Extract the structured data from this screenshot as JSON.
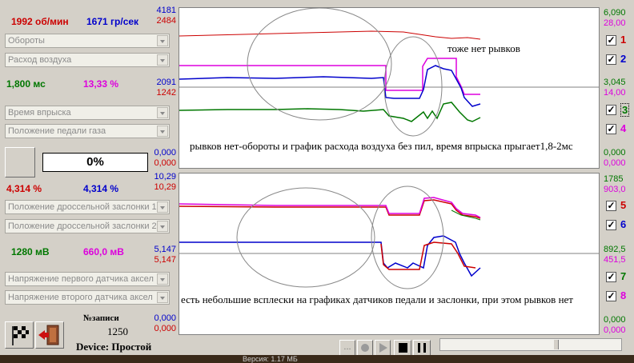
{
  "left": {
    "rpm": "1992 об/мин",
    "airflow_rate": "1671 гр/сек",
    "combo1": "Обороты",
    "combo2": "Расход воздуха",
    "injection_ms": "1,800 мс",
    "percent1": "13,33 %",
    "combo3": "Время впрыска",
    "combo4": "Положение педали газа",
    "progress": "0%",
    "throttle_pct_a": "4,314 %",
    "throttle_pct_b": "4,314 %",
    "combo5": "Положение дроссельной заслонки 1",
    "combo6": "Положение дроссельной заслонки 2",
    "mv1": "1280 мВ",
    "mv2": "660,0 мВ",
    "combo7": "Напряжение первого датчика аксел",
    "combo8": "Напряжение второго датчика аксел",
    "record_label": "№записи",
    "record_value": "1250",
    "device": "Device:  Простой"
  },
  "axes": {
    "top_left": [
      "4181",
      "2484",
      "2091",
      "1242",
      "0,000",
      "0,000"
    ],
    "top_right": [
      "6,090",
      "28,00",
      "3,045",
      "14,00",
      "0,000",
      "0,000"
    ],
    "bottom_left": [
      "10,29",
      "10,29",
      "5,147",
      "5,147",
      "0,000",
      "0,000"
    ],
    "bottom_right": [
      "1785",
      "903,0",
      "892,5",
      "451,5",
      "0,000",
      "0,000"
    ]
  },
  "checkboxes": [
    "1",
    "2",
    "3",
    "4",
    "5",
    "6",
    "7",
    "8"
  ],
  "check_mark": "✓",
  "annotations": {
    "top_note": "тоже нет рывков",
    "mid_note": "рывков нет-обороты и график расхода воздуха без пил, время впрыска прыгает1,8-2мс",
    "bottom_note": "есть небольшие всплески на графиках датчиков педали и заслонки, при этом рывков нет"
  },
  "transport": {
    "more": "..."
  },
  "taskbar_text": "Версия: 1.17 МБ",
  "colors": {
    "red": "#cc0000",
    "blue": "#0000cc",
    "green": "#007700",
    "magenta": "#dd00dd",
    "darkred": "#aa0000"
  }
}
